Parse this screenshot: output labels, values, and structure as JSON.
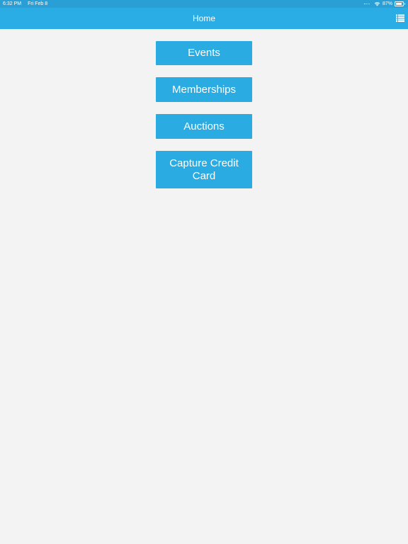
{
  "status_bar": {
    "time": "6:32 PM",
    "date": "Fri Feb 8",
    "battery_percent": "87%",
    "battery_level": 0.87,
    "wifi_icon": "wifi-icon",
    "battery_icon": "battery-icon"
  },
  "nav": {
    "title": "Home",
    "menu_icon": "list-icon"
  },
  "menu": {
    "events": "Events",
    "memberships": "Memberships",
    "auctions": "Auctions",
    "capture_credit_card": "Capture Credit Card"
  },
  "colors": {
    "status_bar": "#2a9fd6",
    "nav_bar": "#2aade4",
    "button": "#2aace2",
    "background": "#f3f3f3",
    "text_on_accent": "#ffffff"
  }
}
